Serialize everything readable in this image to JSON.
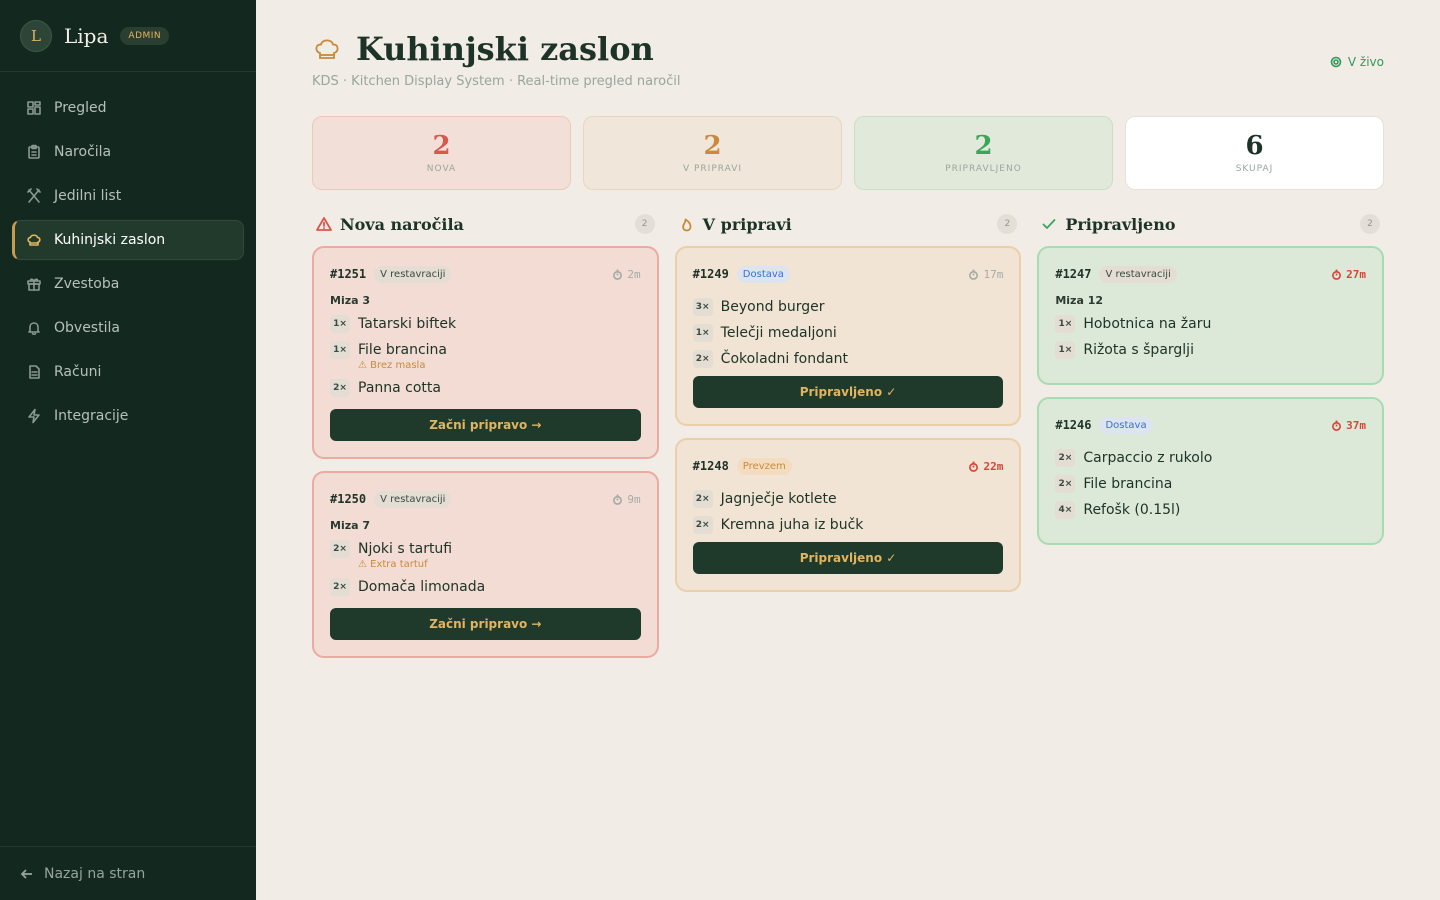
{
  "brand": {
    "initial": "L",
    "name": "Lipa",
    "badge": "ADMIN"
  },
  "nav": [
    {
      "label": "Pregled",
      "icon": "grid-icon",
      "active": false
    },
    {
      "label": "Naročila",
      "icon": "clipboard-icon",
      "active": false
    },
    {
      "label": "Jedilni list",
      "icon": "utensils-icon",
      "active": false
    },
    {
      "label": "Kuhinjski zaslon",
      "icon": "chef-hat-icon",
      "active": true
    },
    {
      "label": "Zvestoba",
      "icon": "gift-icon",
      "active": false
    },
    {
      "label": "Obvestila",
      "icon": "bell-icon",
      "active": false
    },
    {
      "label": "Računi",
      "icon": "receipt-icon",
      "active": false
    },
    {
      "label": "Integracije",
      "icon": "bolt-icon",
      "active": false
    }
  ],
  "back_label": "Nazaj na stran",
  "page": {
    "title": "Kuhinjski zaslon",
    "subtitle": "KDS · Kitchen Display System · Real-time pregled naročil",
    "live_label": "V živo"
  },
  "stats": [
    {
      "value": "2",
      "label": "NOVA"
    },
    {
      "value": "2",
      "label": "V PRIPRAVI"
    },
    {
      "value": "2",
      "label": "PRIPRAVLJENO"
    },
    {
      "value": "6",
      "label": "SKUPAJ"
    }
  ],
  "columns": {
    "new": {
      "title": "Nova naročila",
      "count": "2",
      "orders": [
        {
          "id": "#1251",
          "type": "V restavraciji",
          "time": "2m",
          "table": "Miza 3",
          "items": [
            {
              "qty": "1×",
              "name": "Tatarski biftek",
              "note": ""
            },
            {
              "qty": "1×",
              "name": "File brancina",
              "note": "⚠ Brez masla"
            },
            {
              "qty": "2×",
              "name": "Panna cotta",
              "note": ""
            }
          ],
          "action": "Začni pripravo →"
        },
        {
          "id": "#1250",
          "type": "V restavraciji",
          "time": "9m",
          "table": "Miza 7",
          "items": [
            {
              "qty": "2×",
              "name": "Njoki s tartufi",
              "note": "⚠ Extra tartuf"
            },
            {
              "qty": "2×",
              "name": "Domača limonada",
              "note": ""
            }
          ],
          "action": "Začni pripravo →"
        }
      ]
    },
    "prep": {
      "title": "V pripravi",
      "count": "2",
      "orders": [
        {
          "id": "#1249",
          "type": "Dostava",
          "time": "17m",
          "items": [
            {
              "qty": "3×",
              "name": "Beyond burger"
            },
            {
              "qty": "1×",
              "name": "Telečji medaljoni"
            },
            {
              "qty": "2×",
              "name": "Čokoladni fondant"
            }
          ],
          "action": "Pripravljeno ✓"
        },
        {
          "id": "#1248",
          "type": "Prevzem",
          "time": "22m",
          "items": [
            {
              "qty": "2×",
              "name": "Jagnječje kotlete"
            },
            {
              "qty": "2×",
              "name": "Kremna juha iz bučk"
            }
          ],
          "action": "Pripravljeno ✓"
        }
      ]
    },
    "done": {
      "title": "Pripravljeno",
      "count": "2",
      "orders": [
        {
          "id": "#1247",
          "type": "V restavraciji",
          "time": "27m",
          "table": "Miza 12",
          "items": [
            {
              "qty": "1×",
              "name": "Hobotnica na žaru"
            },
            {
              "qty": "1×",
              "name": "Rižota s šparglji"
            }
          ]
        },
        {
          "id": "#1246",
          "type": "Dostava",
          "time": "37m",
          "items": [
            {
              "qty": "2×",
              "name": "Carpaccio z rukolo"
            },
            {
              "qty": "2×",
              "name": "File brancina"
            },
            {
              "qty": "4×",
              "name": "Refošk (0.15l)"
            }
          ]
        }
      ]
    }
  },
  "colors": {
    "accent": "#e0b461",
    "sidebar": "#13291f",
    "late": "#d9443a",
    "new": "#d9584c",
    "prep": "#c98a3b",
    "done": "#3aa65b"
  }
}
